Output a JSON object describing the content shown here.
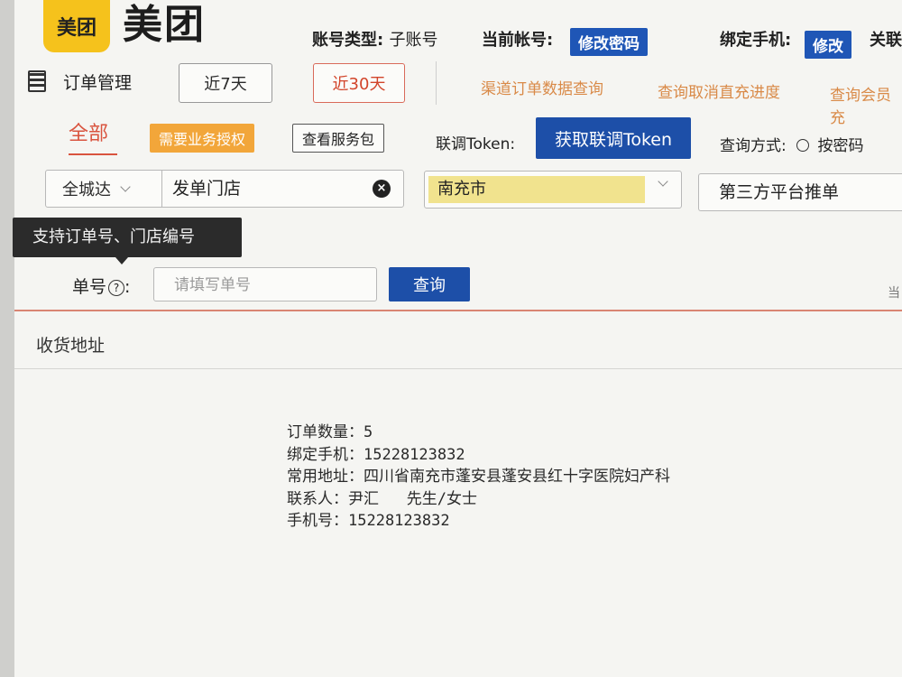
{
  "brand": {
    "badge": "美团",
    "name": "美团"
  },
  "account": {
    "type_label": "账号类型:",
    "type_value": "子账号",
    "current_label": "当前帐号:",
    "change_password": "修改密码",
    "bind_phone_label": "绑定手机:",
    "modify": "修改",
    "associate": "关联"
  },
  "nav": {
    "order_management": "订单管理",
    "last7": "近7天",
    "last30": "近30天",
    "links": [
      "渠道订单数据查询",
      "查询取消直充进度",
      "查询会员充"
    ]
  },
  "toolbar": {
    "tab_all": "全部",
    "need_auth": "需要业务授权",
    "view_package": "查看服务包",
    "token_label": "联调Token:",
    "get_token": "获取联调Token",
    "query_mode_label": "查询方式:",
    "query_mode_option": "按密码"
  },
  "filters": {
    "city_scope": "全城达",
    "store": "发单门店",
    "region": "南充市",
    "platform": "第三方平台推单"
  },
  "tooltip": {
    "text": "支持订单号、门店编号"
  },
  "search": {
    "order_label": "单号",
    "placeholder": "请填写单号",
    "button": "查询",
    "right_hint": "当"
  },
  "section": {
    "address_header": "收货地址"
  },
  "detail": {
    "order_count": "订单数量：5",
    "bound_phone": "绑定手机：15228123832",
    "common_address": "常用地址：四川省南充市蓬安县蓬安县红十字医院妇产科",
    "contact": "联系人：尹汇   先生/女士",
    "phone": "手机号：15228123832"
  },
  "colors": {
    "primary_blue": "#1d4fa8",
    "accent_red": "#d9543f",
    "brand_yellow": "#f5c21c",
    "link_orange": "#d98a48",
    "auth_orange": "#f2a63a",
    "highlight_yellow": "#f1e38e"
  },
  "icons": [
    "menu-icon",
    "chevron-down-icon",
    "clear-icon",
    "help-icon",
    "radio-icon"
  ]
}
